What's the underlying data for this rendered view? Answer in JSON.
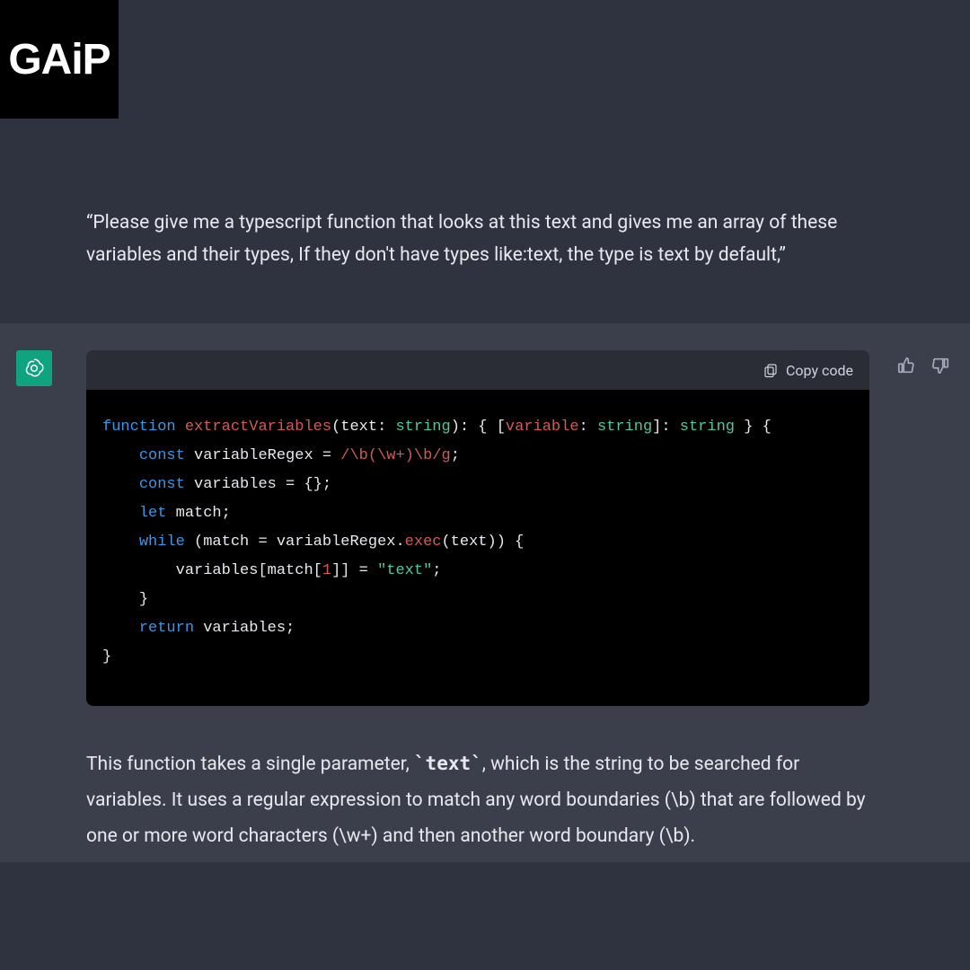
{
  "logo": "GAiP",
  "user_prompt": "“Please give me a typescript function that looks at this text and gives me an array of these variables and their types, If they don't have types like:text, the type is text by default,”",
  "code_header": {
    "copy_label": "Copy code"
  },
  "code": {
    "l1_func": "function",
    "l1_name": "extractVariables",
    "l1_sig1": "(",
    "l1_param": "text",
    "l1_colon": ": ",
    "l1_ptype": "string",
    "l1_sig2": "): { [",
    "l1_idx": "variable",
    "l1_sig3": ": ",
    "l1_itype": "string",
    "l1_sig4": "]: ",
    "l1_rtype": "string",
    "l1_sig5": " } {",
    "l2_const": "const",
    "l2_name": " variableRegex = ",
    "l2_re": "/\\b(\\w+)\\b/g",
    "l2_semi": ";",
    "l3_const": "const",
    "l3_rest": " variables = {};",
    "l4_let": "let",
    "l4_rest": " match;",
    "l5_while": "while",
    "l5_a": " (match = variableRegex.",
    "l5_exec": "exec",
    "l5_b": "(text)) {",
    "l6_a": "variables[match[",
    "l6_n": "1",
    "l6_b": "]] = ",
    "l6_s": "\"text\"",
    "l6_c": ";",
    "l7": "}",
    "l8_ret": "return",
    "l8_rest": " variables;",
    "l9": "}"
  },
  "explanation_pre": "This function takes a single parameter, ",
  "explanation_code": "`text`",
  "explanation_post": ", which is the string to be searched for variables. It uses a regular expression to match any word boundaries (\\b) that are followed by one or more word characters (\\w+) and then another word boundary (\\b).",
  "icons": {
    "avatar": "openai-logo-icon",
    "thumbs_up": "thumbs-up-icon",
    "thumbs_down": "thumbs-down-icon",
    "clipboard": "clipboard-icon"
  }
}
